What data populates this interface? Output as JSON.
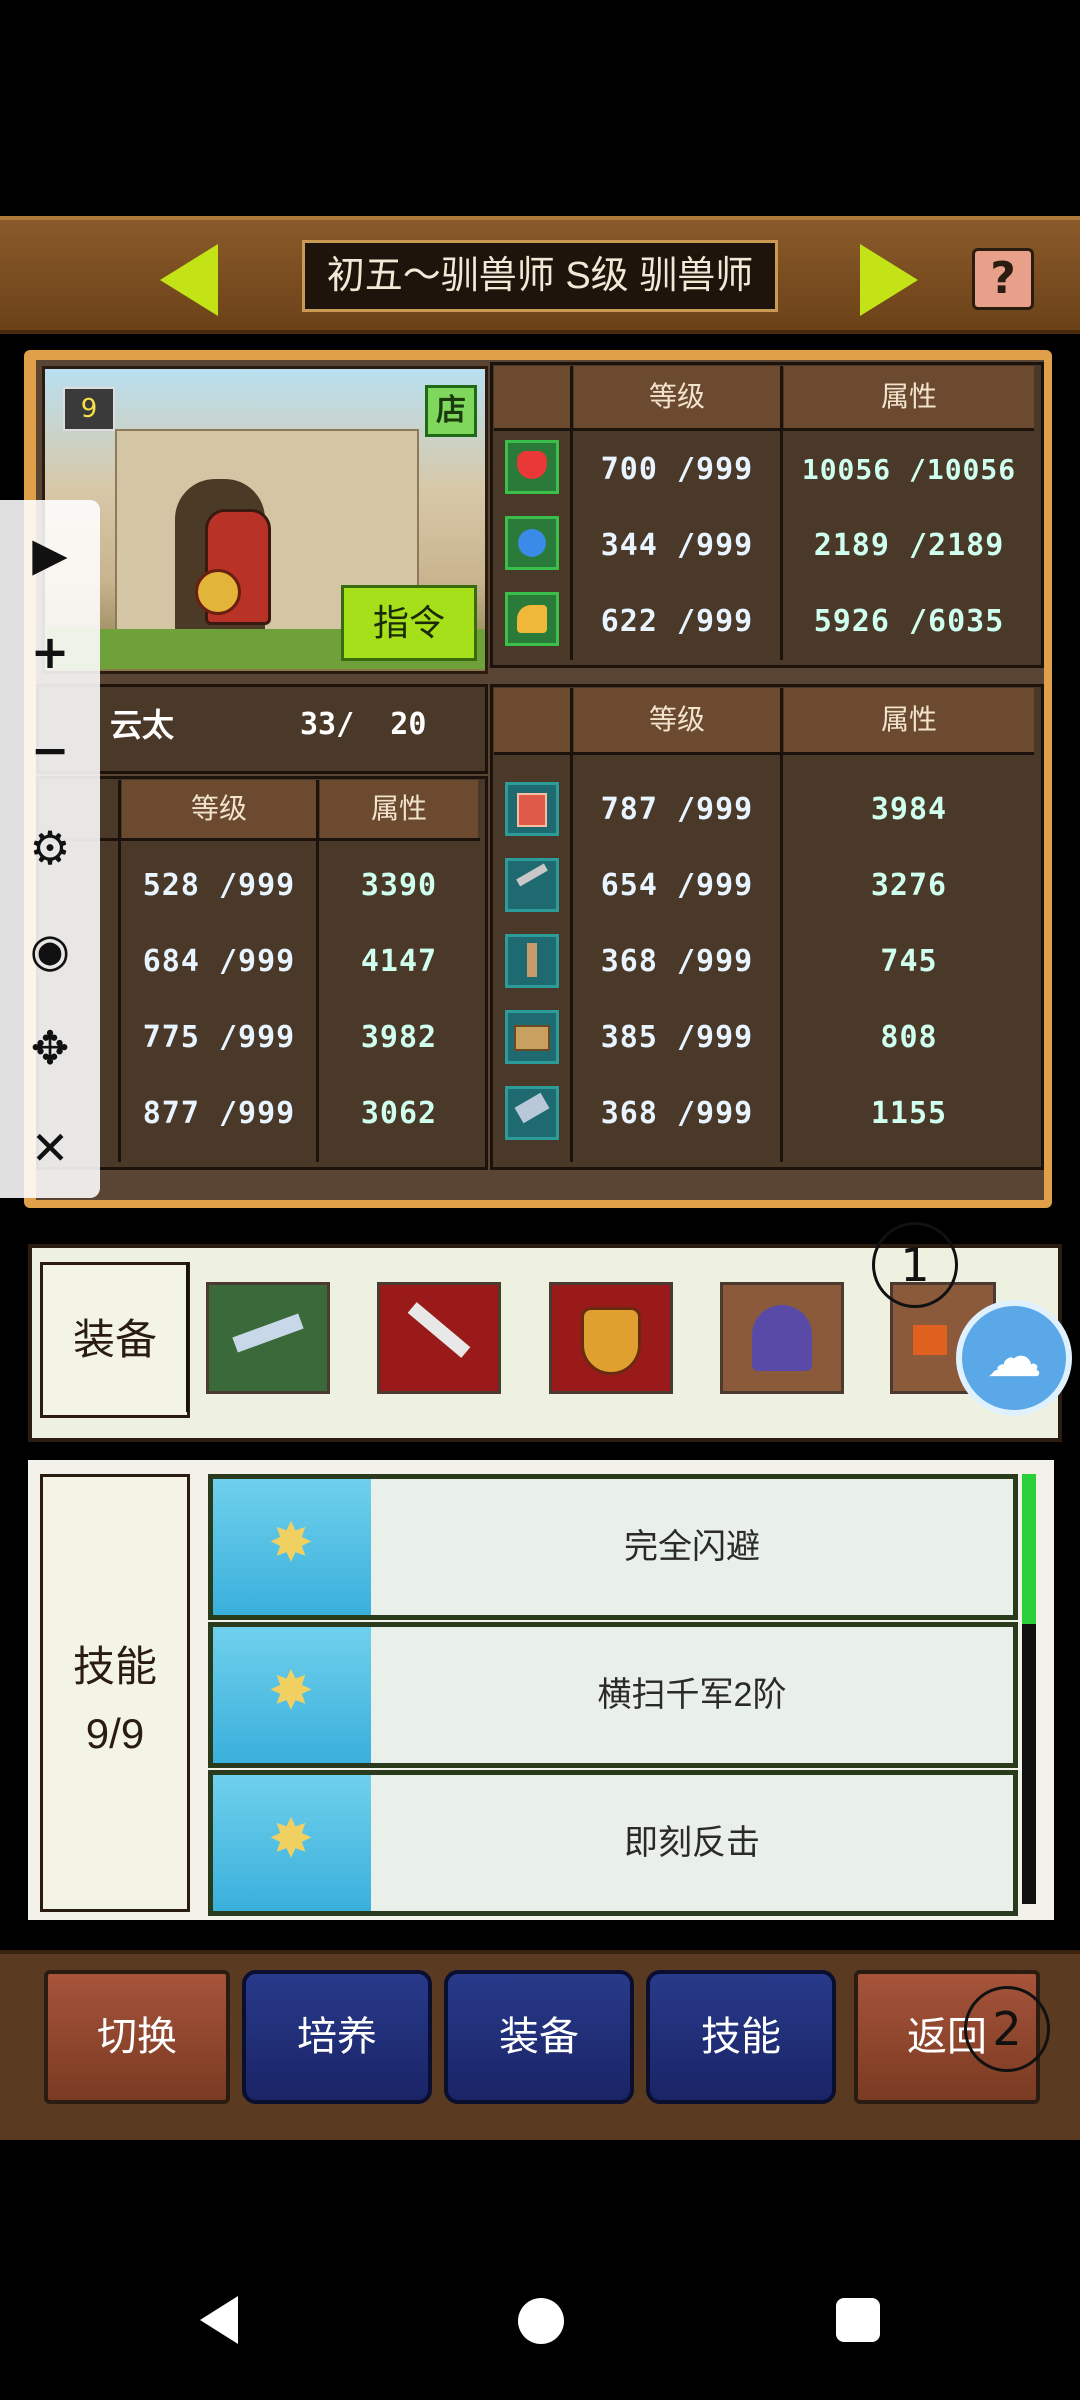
{
  "header": {
    "title": "初五～驯兽师 S级 驯兽师",
    "help_label": "?"
  },
  "portrait": {
    "badge": "9",
    "shop_label": "店",
    "command_label": "指令"
  },
  "top_table": {
    "headers": [
      "等级",
      "属性"
    ],
    "rows": [
      {
        "icon": "heart-icon",
        "level": "700 /999",
        "attr": "10056 /10056"
      },
      {
        "icon": "potion-icon",
        "level": "344 /999",
        "attr": "2189 /2189"
      },
      {
        "icon": "strength-icon",
        "level": "622 /999",
        "attr": "5926 /6035"
      }
    ]
  },
  "left_table": {
    "name": "云太",
    "count": "33/  20",
    "headers": [
      "等级",
      "属性"
    ],
    "rows": [
      {
        "level": "528 /999",
        "attr": "3390"
      },
      {
        "level": "684 /999",
        "attr": "4147"
      },
      {
        "level": "775 /999",
        "attr": "3982"
      },
      {
        "level": "877 /999",
        "attr": "3062"
      }
    ]
  },
  "right_table": {
    "headers": [
      "等级",
      "属性"
    ],
    "rows": [
      {
        "icon": "book-icon",
        "level": "787 /999",
        "attr": "3984"
      },
      {
        "icon": "pickaxe-icon",
        "level": "654 /999",
        "attr": "3276"
      },
      {
        "icon": "shovel-icon",
        "level": "368 /999",
        "attr": "745"
      },
      {
        "icon": "chest-icon",
        "level": "385 /999",
        "attr": "808"
      },
      {
        "icon": "hammer-icon",
        "level": "368 /999",
        "attr": "1155"
      }
    ]
  },
  "equipment": {
    "label": "装备"
  },
  "skills": {
    "label": "技能",
    "count": "9/9",
    "items": [
      "完全闪避",
      "横扫千军2阶",
      "即刻反击"
    ]
  },
  "bottom": {
    "switch": "切换",
    "train": "培养",
    "equip": "装备",
    "skill": "技能",
    "back": "返回"
  },
  "markers": {
    "one": "1",
    "two": "2"
  }
}
